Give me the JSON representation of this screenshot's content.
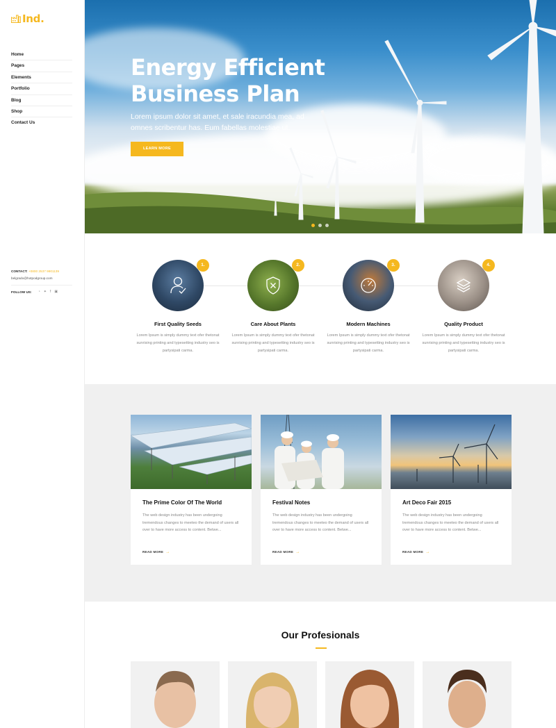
{
  "brand": {
    "logo_text": "Ind.",
    "accent": "#f5b81f"
  },
  "nav": {
    "items": [
      "Home",
      "Pages",
      "Elements",
      "Portfolio",
      "Blog",
      "Shop",
      "Contact Us"
    ]
  },
  "contact": {
    "label": "CONTACT:",
    "phone": "+0800 2537 9901139",
    "email": "belgrado@hotpodgroup.com",
    "follow_label": "FOLLOW US:",
    "social_icons": [
      "rss-icon",
      "twitter-icon",
      "facebook-icon",
      "instagram-icon"
    ]
  },
  "hero": {
    "title_line1": "Energy Efficient",
    "title_line2": "Business Plan",
    "subtitle": "Lorem ipsum dolor sit amet, et sale iracundia mea, ad omnes scribentur has. Eum fabellas molestiae ut.",
    "button": "LEARN MORE",
    "slides": 3,
    "active_slide": 1
  },
  "features": [
    {
      "num": "1.",
      "title": "First Quality Seeds",
      "desc": "Lorem Ipsum is simply dummy text ofer thetonat sunrising printing and typesetting industry seo is partysipati carma.",
      "icon": "user-check-icon"
    },
    {
      "num": "2.",
      "title": "Care About Plants",
      "desc": "Lorem Ipsum is simply dummy text ofer thetonat sunrising printing and typesetting industry seo is partysipati carma.",
      "icon": "shield-x-icon"
    },
    {
      "num": "3.",
      "title": "Modern Machines",
      "desc": "Lorem Ipsum is simply dummy text ofer thetonat sunrising printing and typesetting industry seo is partysipati carma.",
      "icon": "speedometer-icon"
    },
    {
      "num": "4.",
      "title": "Quality Product",
      "desc": "Lorem Ipsum is simply dummy text ofer thetonat sunrising printing and typesetting industry seo is partysipati carma.",
      "icon": "layers-icon"
    }
  ],
  "posts": [
    {
      "title": "The Prime Color Of The World",
      "desc": "The web design industry has been undergoing tremendous changes to meeteo the demand of users all over to have more access to content. Betwe...",
      "more": "READ MORE"
    },
    {
      "title": "Festival Notes",
      "desc": "The web design industry has been undergoing tremendous changes to meeteo the demand of users all over to have more access to content. Betwe...",
      "more": "READ MORE"
    },
    {
      "title": "Art Deco Fair 2015",
      "desc": "The web design industry has been undergoing tremendous changes to meeteo the demand of users all over to have more access to content. Betwe...",
      "more": "READ MORE"
    }
  ],
  "team": {
    "title": "Our Profesionals"
  }
}
